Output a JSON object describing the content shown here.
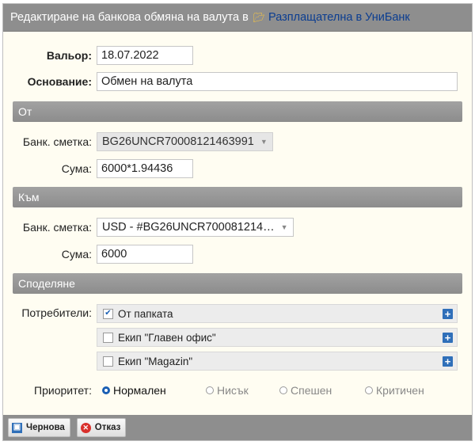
{
  "dialog": {
    "title": "Редактиране на банкова обмяна на валута в",
    "folder_name": "Разплащателна в УниБанк"
  },
  "form": {
    "valor_label": "Вальор",
    "valor_value": "18.07.2022",
    "basis_label": "Основание",
    "basis_value": "Обмен на валута"
  },
  "from": {
    "header": "От",
    "account_label": "Банк. сметка:",
    "account_value": "BG26UNCR70008121463991",
    "sum_label": "Сума:",
    "sum_value": "6000*1.94436"
  },
  "to": {
    "header": "Към",
    "account_label": "Банк. сметка:",
    "account_value": "USD - #BG26UNCR700081214…",
    "sum_label": "Сума:",
    "sum_value": "6000"
  },
  "sharing": {
    "header": "Споделяне",
    "users_label": "Потребители:",
    "users": [
      {
        "label": "От папката",
        "checked": true
      },
      {
        "label": "Екип \"Главен офис\"",
        "checked": false
      },
      {
        "label": "Екип \"Magazin\"",
        "checked": false
      }
    ],
    "priority_label": "Приоритет:",
    "priorities": [
      {
        "label": "Нормален",
        "selected": true
      },
      {
        "label": "Нисък",
        "selected": false
      },
      {
        "label": "Спешен",
        "selected": false
      },
      {
        "label": "Критичен",
        "selected": false
      }
    ]
  },
  "footer": {
    "draft_label": "Чернова",
    "cancel_label": "Отказ"
  },
  "colors": {
    "title_bar": "#8e8e8e",
    "dialog_bg": "#fffdf2",
    "link_blue": "#0b3d91",
    "accent_blue": "#1a5fb4"
  }
}
